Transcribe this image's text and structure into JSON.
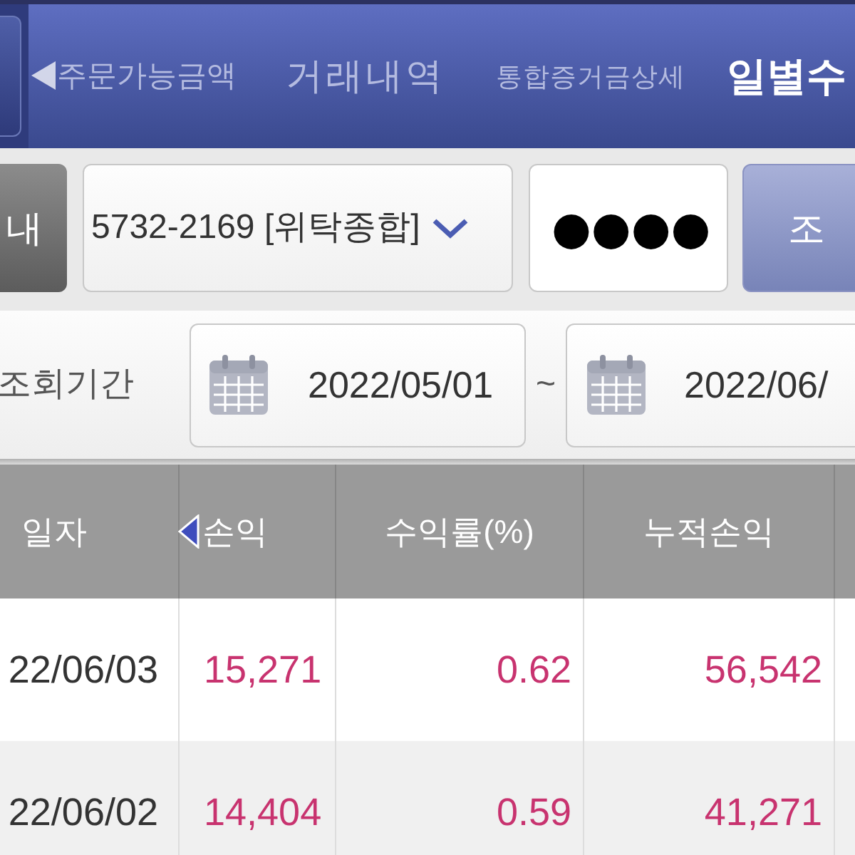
{
  "top_tabs": [
    {
      "label": "주문가능금액",
      "selected": false
    },
    {
      "label": "거래내역",
      "selected": false
    },
    {
      "label": "통합증거금상세",
      "selected": false
    },
    {
      "label": "일별수",
      "selected": true
    }
  ],
  "account_bar": {
    "guide_button": "내",
    "account_select": {
      "value": "5732-2169 [위탁종합]"
    },
    "password": {
      "value": "●●●●"
    },
    "search_button": "조"
  },
  "period": {
    "label": "조회기간",
    "start_date": "2022/05/01",
    "separator": "~",
    "end_date": "2022/06/"
  },
  "table": {
    "columns": [
      "일자",
      "손익",
      "수익률(%)",
      "누적손익"
    ],
    "rows": [
      [
        "22/06/03",
        "15,271",
        "0.62",
        "56,542"
      ],
      [
        "22/06/02",
        "14,404",
        "0.59",
        "41,271"
      ]
    ]
  }
}
